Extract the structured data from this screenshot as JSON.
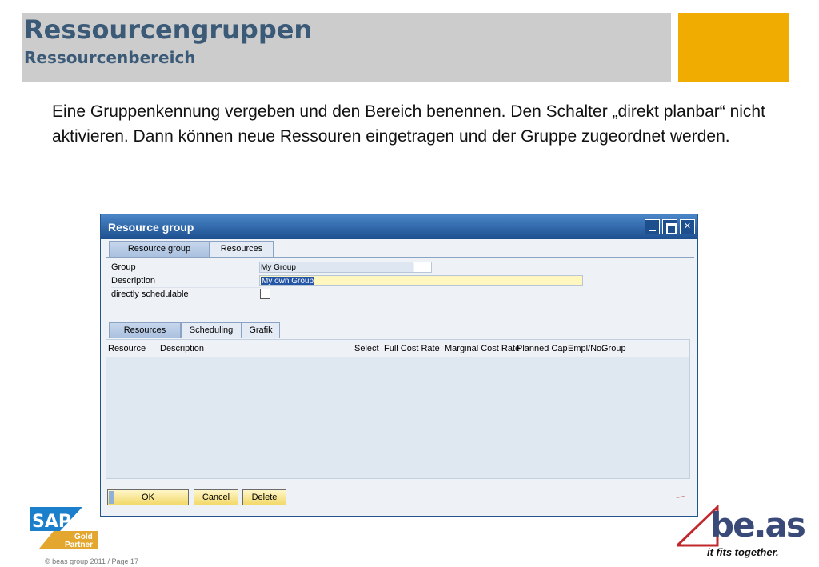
{
  "slide": {
    "title": "Ressourcengruppen",
    "subtitle": "Ressourcenbereich",
    "body": "Eine Gruppenkennung vergeben und den Bereich benennen. Den Schalter „direkt planbar“ nicht aktivieren. Dann können neue Ressouren eingetragen und der Gruppe zugeordnet werden.",
    "footer": "© beas group 2011 / Page 17",
    "accent_color": "#f0ac00",
    "title_color": "#3a5a78"
  },
  "window": {
    "title": "Resource group",
    "top_tabs": [
      {
        "label": "Resource group",
        "active": true
      },
      {
        "label": "Resources",
        "active": false
      }
    ],
    "fields": {
      "group_label": "Group",
      "group_value": "My Group",
      "description_label": "Description",
      "description_value": "My own Group",
      "schedulable_label": "directly schedulable",
      "schedulable_checked": false
    },
    "sub_tabs": [
      {
        "label": "Resources",
        "active": true
      },
      {
        "label": "Scheduling",
        "active": false
      },
      {
        "label": "Grafik",
        "active": false
      }
    ],
    "grid_columns": [
      "Resource",
      "Description",
      "Select",
      "Full Cost Rate",
      "Marginal Cost Rate",
      "Planned Caps",
      "Empl/No.",
      "Group"
    ],
    "buttons": {
      "ok": "OK",
      "cancel": "Cancel",
      "delete": "Delete"
    }
  },
  "logos": {
    "sap_word": "SAP",
    "sap_badge_line1": "Gold",
    "sap_badge_line2": "Partner",
    "beas_word": "be.as",
    "beas_tagline": "it fits together."
  }
}
